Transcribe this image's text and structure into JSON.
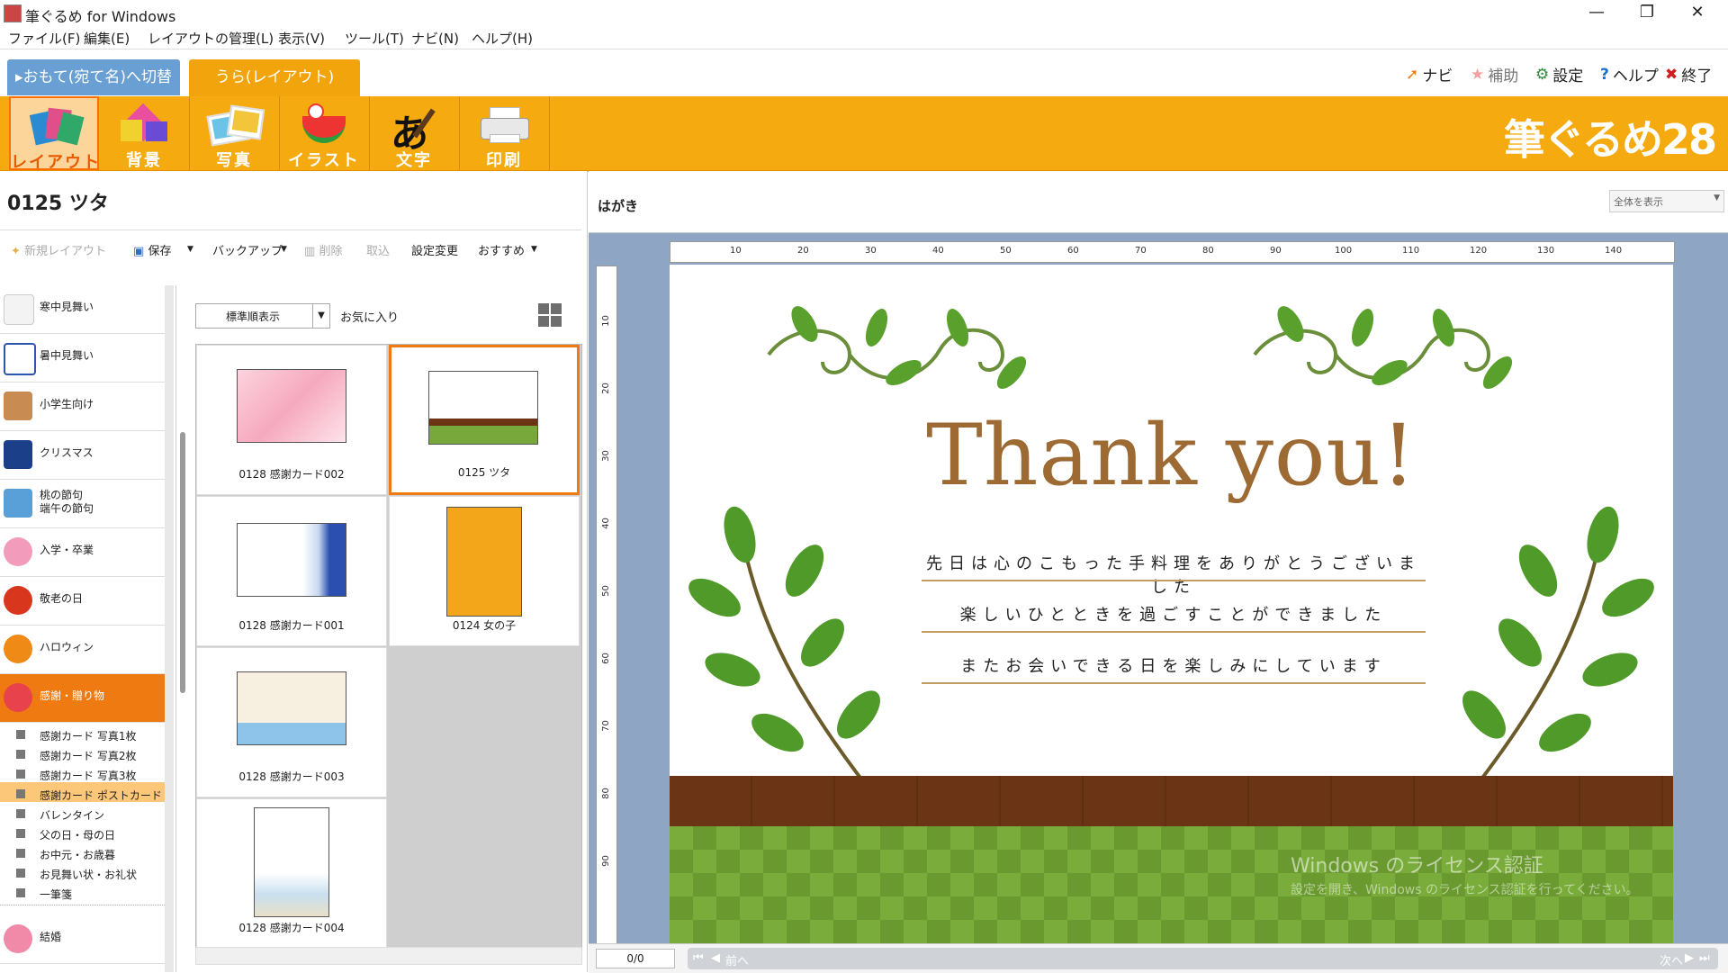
{
  "window": {
    "title": "筆ぐるめ for Windows",
    "minimize": "—",
    "restore": "❐",
    "close": "✕"
  },
  "menu": [
    "ファイル(F)",
    "編集(E)",
    "レイアウトの管理(L)",
    "表示(V)",
    "ツール(T)",
    "ナビ(N)",
    "ヘルプ(H)"
  ],
  "tabs": {
    "omote": "▸おもて(宛て名)へ切替",
    "ura": "うら(レイアウト)"
  },
  "top_right": {
    "navi": "ナビ",
    "hojo": "補助",
    "settei": "設定",
    "help": "ヘルプ",
    "exit": "終了"
  },
  "tools": [
    "レイアウト",
    "背景",
    "写真",
    "イラスト",
    "文字",
    "印刷"
  ],
  "brand": "筆ぐるめ28",
  "layout_title": "0125 ツタ",
  "left_toolbar": {
    "new": "新規レイアウト",
    "save": "保存",
    "backup": "バックアップ",
    "delete": "削除",
    "import": "取込",
    "change": "設定変更",
    "recommend": "おすすめ"
  },
  "categories": [
    "寒中見舞い",
    "暑中見舞い",
    "小学生向け",
    "クリスマス",
    "桃の節句\n端午の節句",
    "入学・卒業",
    "敬老の日",
    "ハロウィン",
    "感謝・贈り物"
  ],
  "subcategories": [
    "感謝カード 写真1枚",
    "感謝カード 写真2枚",
    "感謝カード 写真3枚",
    "感謝カード ポストカード",
    "バレンタイン",
    "父の日・母の日",
    "お中元・お歳暮",
    "お見舞い状・お礼状",
    "一筆箋"
  ],
  "last_category": "結婚",
  "sort": {
    "selected": "標準順表示",
    "favorites": "お気に入り"
  },
  "thumbnails": [
    "0128 感謝カード002",
    "0125 ツタ",
    "0128 感謝カード001",
    "0124 女の子",
    "0128 感謝カード003",
    "0128 感謝カード004"
  ],
  "canvas": {
    "paper": "はがき",
    "zoom": "全体を表示",
    "ruler_top": [
      "10",
      "20",
      "30",
      "40",
      "50",
      "60",
      "70",
      "80",
      "90",
      "100",
      "110",
      "120",
      "130",
      "140"
    ],
    "ruler_left": [
      "10",
      "20",
      "30",
      "40",
      "50",
      "60",
      "70",
      "80",
      "90"
    ],
    "title": "Thank you!",
    "messages": [
      "先日は心のこもった手料理をありがとうございました",
      "楽しいひとときを過ごすことができました",
      "またお会いできる日を楽しみにしています"
    ],
    "watermark_title": "Windows のライセンス認証",
    "watermark_sub": "設定を開き、Windows のライセンス認証を行ってください。"
  },
  "pager": {
    "page": "0/0",
    "prev": "前へ",
    "next": "次へ"
  },
  "colors": {
    "toolbar": "#f5ab0f",
    "accent": "#f07a12",
    "tab_blue": "#6a9fd4"
  }
}
